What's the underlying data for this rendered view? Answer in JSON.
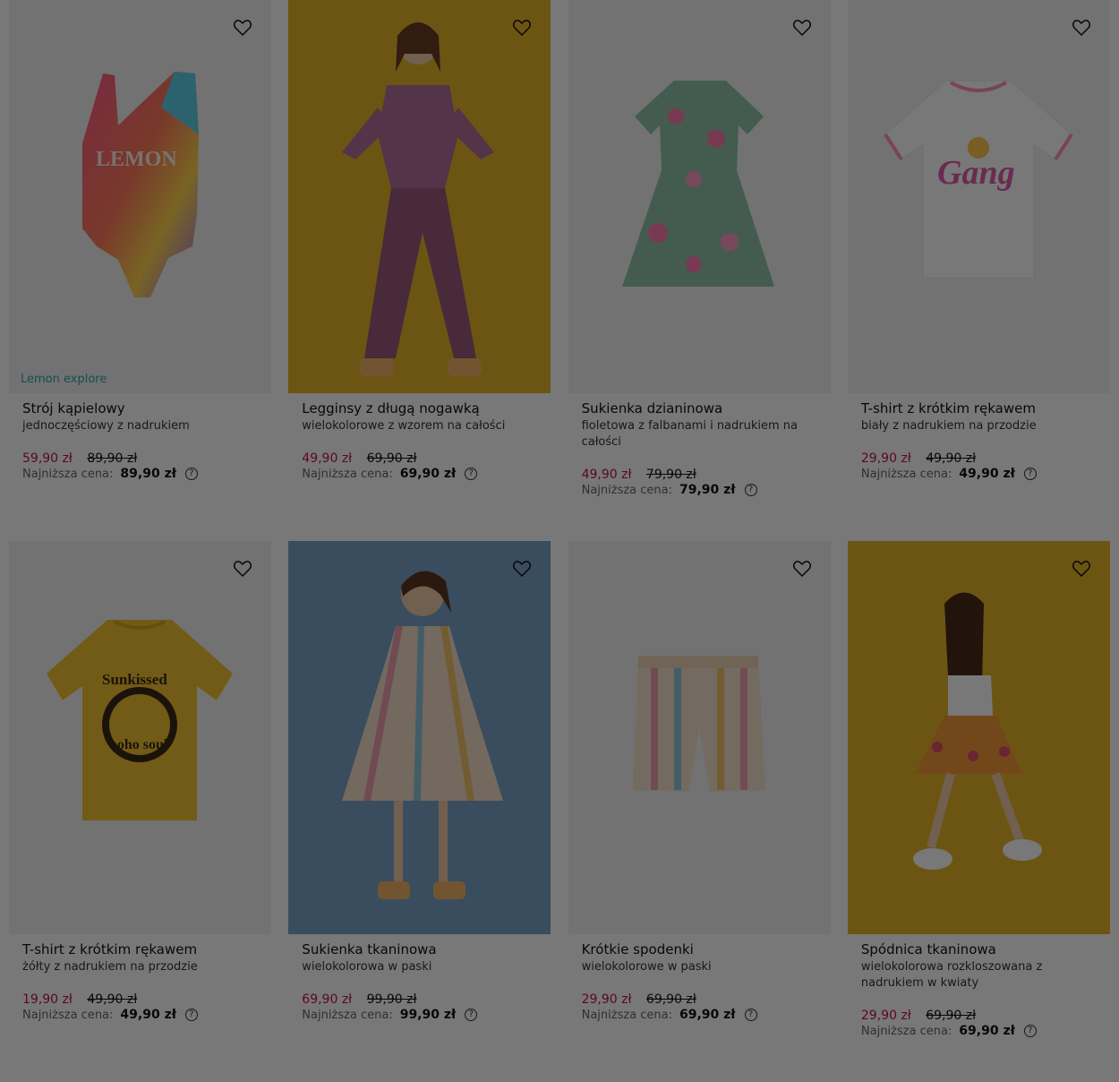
{
  "products": [
    {
      "brand": "Lemon explore",
      "title": "Strój kąpielowy",
      "subtitle": "jednoczęściowy z nadrukiem",
      "price": "59,90 zł",
      "old_price": "89,90 zł",
      "lowest_label": "Najniższa cena:",
      "lowest_price": "89,90 zł",
      "print_text": "LEMON"
    },
    {
      "brand": "",
      "title": "Legginsy z długą nogawką",
      "subtitle": "wielokolorowe z wzorem na całości",
      "price": "49,90 zł",
      "old_price": "69,90 zł",
      "lowest_label": "Najniższa cena:",
      "lowest_price": "69,90 zł"
    },
    {
      "brand": "",
      "title": "Sukienka dzianinowa",
      "subtitle": "fioletowa z falbanami i nadrukiem na całości",
      "price": "49,90 zł",
      "old_price": "79,90 zł",
      "lowest_label": "Najniższa cena:",
      "lowest_price": "79,90 zł"
    },
    {
      "brand": "",
      "title": "T-shirt z krótkim rękawem",
      "subtitle": "biały z nadrukiem na przodzie",
      "price": "29,90 zł",
      "old_price": "49,90 zł",
      "lowest_label": "Najniższa cena:",
      "lowest_price": "49,90 zł",
      "print_text": "Gang"
    },
    {
      "brand": "",
      "title": "T-shirt z krótkim rękawem",
      "subtitle": "żółty z nadrukiem na przodzie",
      "price": "19,90 zł",
      "old_price": "49,90 zł",
      "lowest_label": "Najniższa cena:",
      "lowest_price": "49,90 zł",
      "print_text": "Sunkissed",
      "print_text_2": "boho soul"
    },
    {
      "brand": "",
      "title": "Sukienka tkaninowa",
      "subtitle": "wielokolorowa w paski",
      "price": "69,90 zł",
      "old_price": "99,90 zł",
      "lowest_label": "Najniższa cena:",
      "lowest_price": "99,90 zł"
    },
    {
      "brand": "",
      "title": "Krótkie spodenki",
      "subtitle": "wielokolorowe w paski",
      "price": "29,90 zł",
      "old_price": "69,90 zł",
      "lowest_label": "Najniższa cena:",
      "lowest_price": "69,90 zł"
    },
    {
      "brand": "",
      "title": "Spódnica tkaninowa",
      "subtitle": "wielokolorowa rozkloszowana z nadrukiem w kwiaty",
      "price": "29,90 zł",
      "old_price": "69,90 zł",
      "lowest_label": "Najniższa cena:",
      "lowest_price": "69,90 zł"
    }
  ],
  "icons": {
    "favorite": "heart-icon",
    "help": "question-circle-icon"
  },
  "colors": {
    "sale_price": "#c41240",
    "brand_tag": "#2fa7a0",
    "overlay": "rgba(0,0,0,0.53)"
  }
}
